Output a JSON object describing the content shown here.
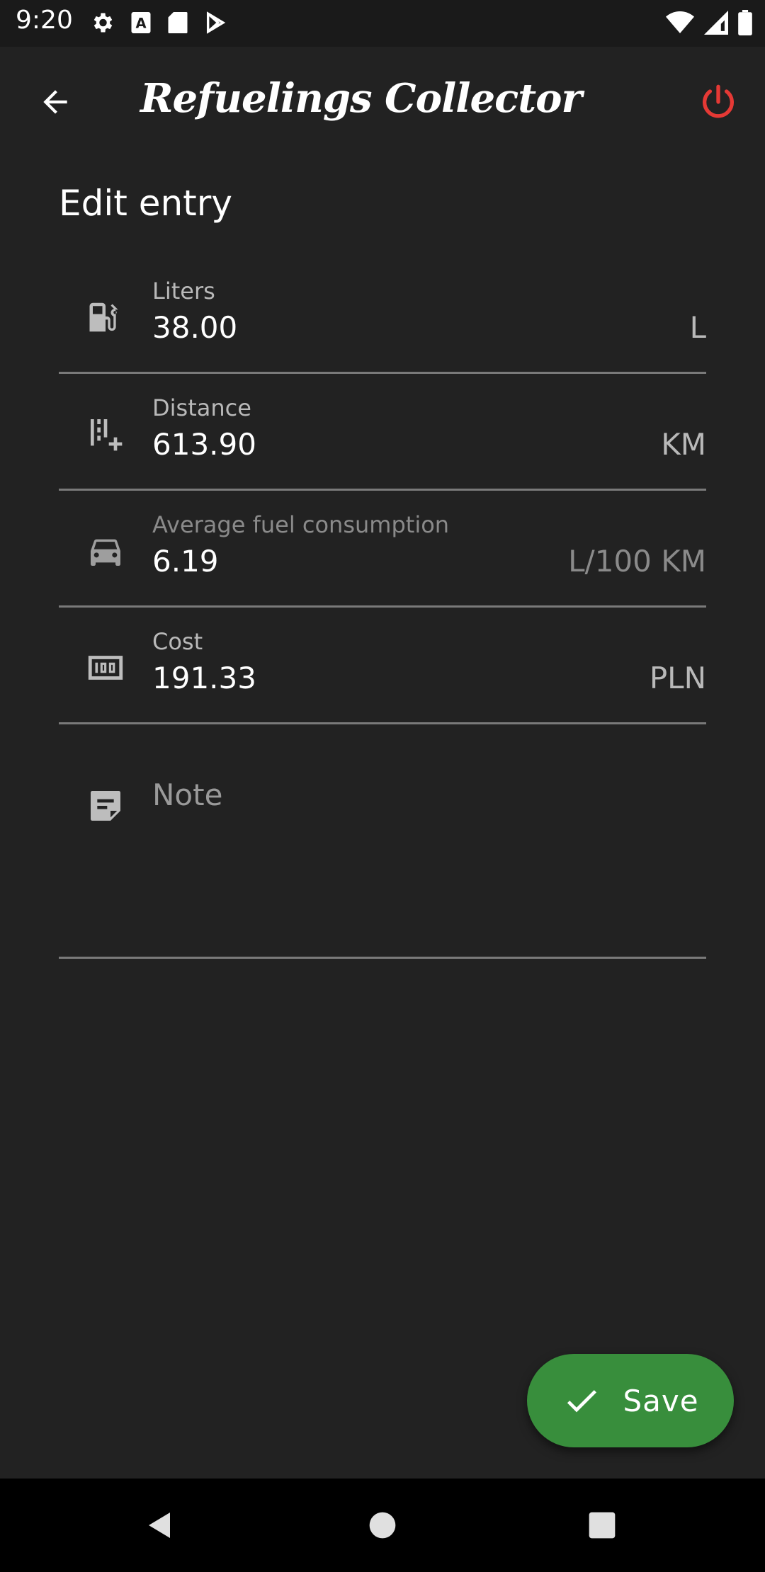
{
  "status_bar": {
    "time": "9:20",
    "left_icons": [
      "gear-icon",
      "a-icon",
      "sd-card-icon",
      "play-store-icon"
    ],
    "right_icons": [
      "wifi-icon",
      "signal-icon",
      "battery-icon"
    ]
  },
  "app_bar": {
    "title": "Refuelings Collector",
    "back_icon": "arrow-left-icon",
    "power_icon": "power-icon",
    "power_color": "#e53935"
  },
  "page": {
    "title": "Edit entry"
  },
  "fields": {
    "liters": {
      "label": "Liters",
      "value": "38.00",
      "unit": "L",
      "icon": "fuel-pump-icon"
    },
    "distance": {
      "label": "Distance",
      "value": "613.90",
      "unit": "KM",
      "icon": "distance-icon"
    },
    "consumption": {
      "label": "Average fuel consumption",
      "value": "6.19",
      "unit": "L/100 KM",
      "icon": "car-icon"
    },
    "cost": {
      "label": "Cost",
      "value": "191.33",
      "unit": "PLN",
      "icon": "money-icon"
    },
    "note": {
      "placeholder": "Note",
      "icon": "note-icon"
    }
  },
  "fab": {
    "label": "Save",
    "icon": "check-icon",
    "color": "#388e3c"
  },
  "nav_bar": {
    "icons": [
      "back-triangle-icon",
      "home-circle-icon",
      "recents-square-icon"
    ]
  }
}
